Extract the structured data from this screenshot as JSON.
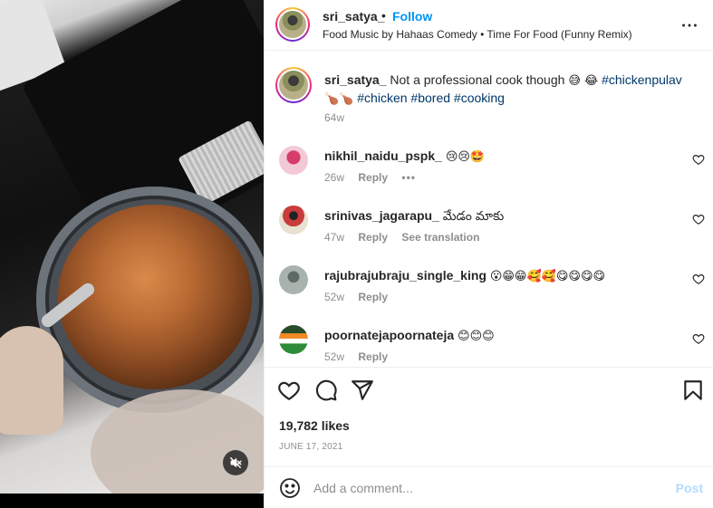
{
  "post": {
    "username": "sri_satya_",
    "dot": "•",
    "follow_label": "Follow",
    "audio": "Food Music by Hahaas Comedy • Time For Food (Funny Remix)"
  },
  "caption": {
    "username": "sri_satya_",
    "text": " Not a professional cook though ",
    "emojis1": "😅 😂",
    "hashtag1": "#chickenpulav",
    "emojis2": "🍗🍗",
    "hashtag2": "#chicken",
    "hashtag3": "#bored",
    "hashtag4": "#cooking",
    "time": "64w"
  },
  "comments": [
    {
      "username": "nikhil_naidu_pspk_",
      "text": "😢😢🤩",
      "time": "26w",
      "reply": "Reply",
      "more": "•••",
      "avatar_color": "#f0c6d2"
    },
    {
      "username": "srinivas_jagarapu_",
      "text": "మేడం మాకు",
      "time": "47w",
      "reply": "Reply",
      "translate": "See translation",
      "avatar_color": "#c83c3c"
    },
    {
      "username": "rajubrajubraju_single_king",
      "text": "😮😁😁🥰🥰😋😋😋😋",
      "time": "52w",
      "reply": "Reply",
      "avatar_color": "#7d8a86"
    },
    {
      "username": "poornatejapoornateja",
      "text": "😊😊😊",
      "time": "52w",
      "reply": "Reply",
      "avatar_color": "#3a7d3a"
    }
  ],
  "actions": {
    "likes": "19,782 likes",
    "date": "JUNE 17, 2021"
  },
  "add_comment": {
    "placeholder": "Add a comment...",
    "post_label": "Post"
  },
  "colors": {
    "accent": "#0095f6",
    "hashtag": "#00376b",
    "muted": "#8e8e8e",
    "post_disabled": "#b3dbff"
  },
  "icons": {
    "more": "more-horizontal-icon",
    "heart": "heart-icon",
    "comment": "comment-icon",
    "share": "share-icon",
    "save": "bookmark-icon",
    "emoji": "smile-icon",
    "mute": "muted-speaker-icon"
  }
}
